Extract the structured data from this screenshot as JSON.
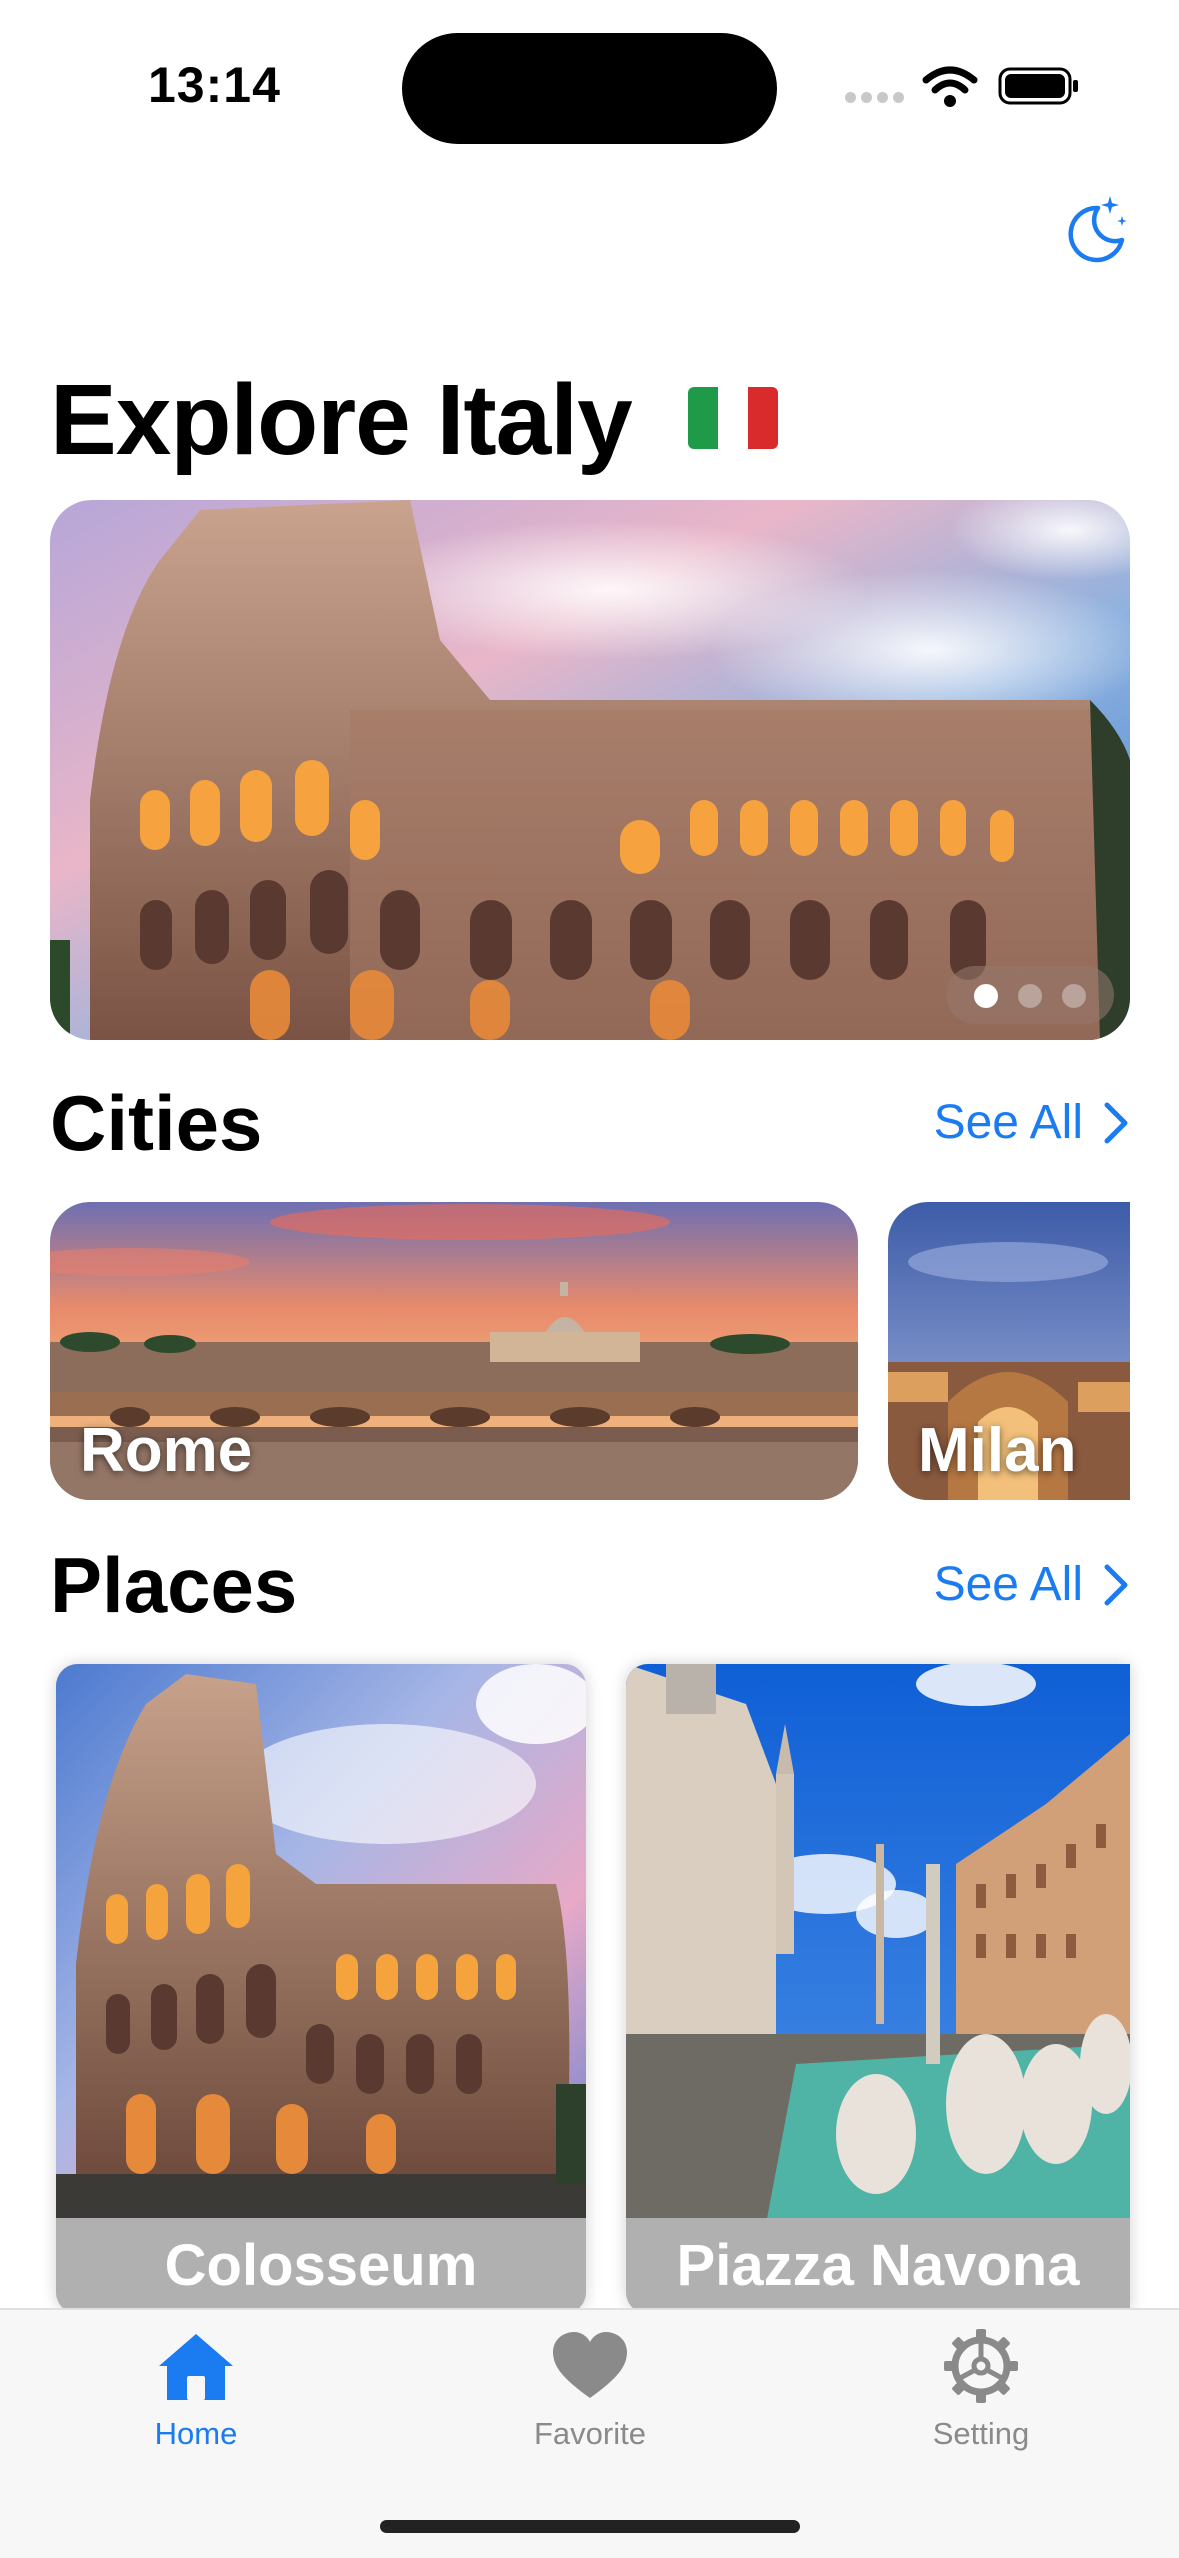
{
  "status_bar": {
    "time": "13:14"
  },
  "header": {
    "title": "Explore Italy"
  },
  "sections": {
    "cities": {
      "title": "Cities",
      "see_all": "See All"
    },
    "places": {
      "title": "Places",
      "see_all": "See All"
    }
  },
  "cities": [
    {
      "name": "Rome"
    },
    {
      "name": "Milan"
    }
  ],
  "places": [
    {
      "name": "Colosseum"
    },
    {
      "name": "Piazza Navona"
    }
  ],
  "hero": {
    "pages": 3,
    "current_page": 1
  },
  "tab_bar": {
    "items": [
      {
        "label": "Home",
        "icon": "house-icon",
        "active": true
      },
      {
        "label": "Favorite",
        "icon": "heart-icon",
        "active": false
      },
      {
        "label": "Setting",
        "icon": "gear-icon",
        "active": false
      }
    ]
  },
  "colors": {
    "accent": "#1a7cf0",
    "inactive": "#8a8a8a"
  }
}
